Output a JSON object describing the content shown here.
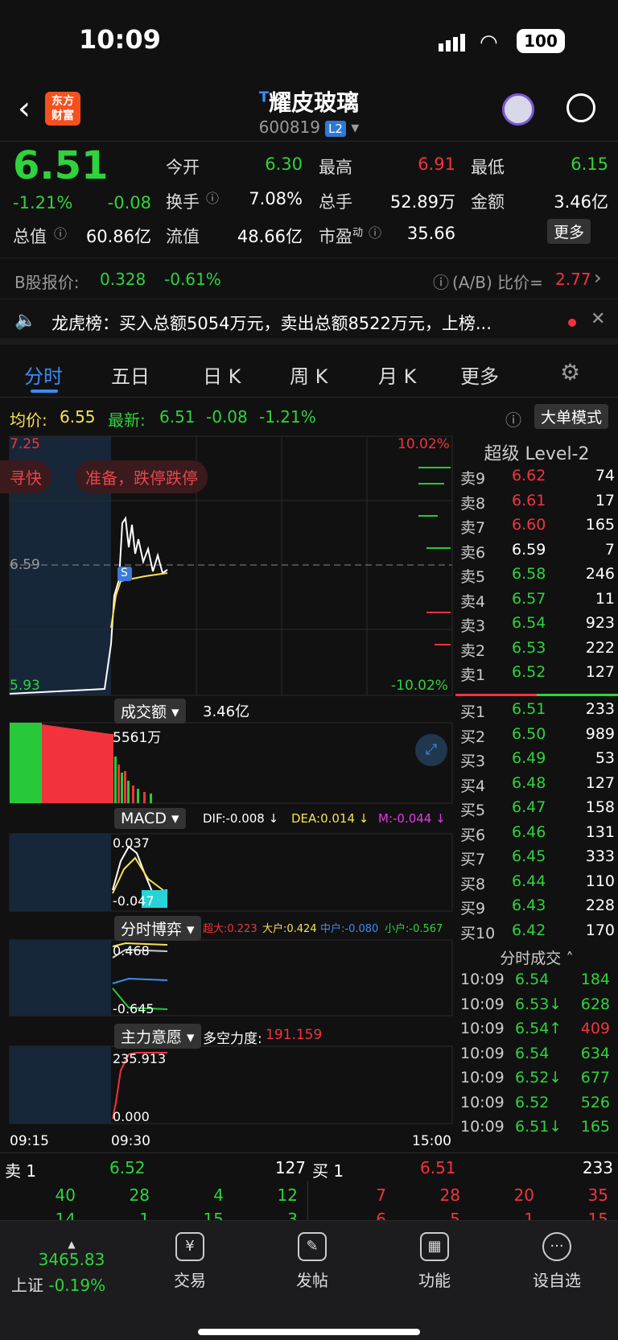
{
  "status": {
    "time": "10:09",
    "battery": "100"
  },
  "header": {
    "name": "耀皮玻璃",
    "prefix": "T",
    "code": "600819",
    "level": "L2",
    "logo_l1": "东方",
    "logo_l2": "财富"
  },
  "quote": {
    "price": "6.51",
    "pct": "-1.21%",
    "chg": "-0.08",
    "open_l": "今开",
    "open": "6.30",
    "high_l": "最高",
    "high": "6.91",
    "low_l": "最低",
    "low": "6.15",
    "turn_l": "换手",
    "turn": "7.08%",
    "vol_l": "总手",
    "vol": "52.89万",
    "amt_l": "金额",
    "amt": "3.46亿",
    "mcap_l": "总值",
    "mcap": "60.86亿",
    "float_l": "流值",
    "float": "48.66亿",
    "pe_l": "市盈",
    "pe_sup": "动",
    "pe": "35.66",
    "more": "更多"
  },
  "bshare": {
    "label": "B股报价:",
    "price": "0.328",
    "pct": "-0.61%",
    "ratio_l": "(A/B) 比价=",
    "ratio": "2.77"
  },
  "dragon": {
    "text": "龙虎榜：买入总额5054万元，卖出总额8522万元，上榜..."
  },
  "tabs": [
    "分时",
    "五日",
    "日 K",
    "周 K",
    "月 K",
    "更多"
  ],
  "info": {
    "avg_l": "均价:",
    "avg": "6.55",
    "last_l": "最新:",
    "last": "6.51",
    "chg": "-0.08",
    "pct": "-1.21%",
    "mode": "大单模式"
  },
  "chart": {
    "top_price": "7.25",
    "bottom_price": "5.93",
    "ref_price": "6.59",
    "top_pct": "10.02%",
    "bottom_pct": "-10.02%",
    "pill1": "寻快",
    "pill2": "准备，跌停跌停",
    "marker": "S",
    "vol_label": "成交额",
    "vol_value": "3.46亿",
    "vol_max": "5561万",
    "macd_label": "MACD",
    "dif": "DIF:-0.008 ↓",
    "dea": "DEA:0.014 ↓",
    "m": "M:-0.044 ↓",
    "macd_top": "0.037",
    "macd_bot": "-0.047",
    "game_label": "分时博弈",
    "super": "超大:0.223",
    "big": "大户:0.424",
    "mid": "中户:-0.080",
    "small": "小户:-0.567",
    "game_top": "0.468",
    "game_bot": "-0.645",
    "main_label": "主力意愿",
    "force_l": "多空力度:",
    "force": "191.159",
    "main_top": "235.913",
    "main_bot": "0.000",
    "t_start": "09:15",
    "t_open": "09:30",
    "t_end": "15:00"
  },
  "chart_data": {
    "type": "line",
    "x": [
      "09:15",
      "09:30",
      "15:00"
    ],
    "ylim": [
      5.93,
      7.25
    ],
    "reference": 6.59,
    "series": [
      {
        "name": "最新",
        "values": [
          6.15,
          6.91,
          6.51
        ]
      },
      {
        "name": "均价",
        "values": [
          6.3,
          6.55,
          6.55
        ]
      }
    ]
  },
  "level2": {
    "title": "超级 Level-2",
    "asks": [
      [
        "卖9",
        "6.62",
        "74"
      ],
      [
        "卖8",
        "6.61",
        "17"
      ],
      [
        "卖7",
        "6.60",
        "165"
      ],
      [
        "卖6",
        "6.59",
        "7"
      ],
      [
        "卖5",
        "6.58",
        "246"
      ],
      [
        "卖4",
        "6.57",
        "11"
      ],
      [
        "卖3",
        "6.54",
        "923"
      ],
      [
        "卖2",
        "6.53",
        "222"
      ],
      [
        "卖1",
        "6.52",
        "127"
      ]
    ],
    "bids": [
      [
        "买1",
        "6.51",
        "233"
      ],
      [
        "买2",
        "6.50",
        "989"
      ],
      [
        "买3",
        "6.49",
        "53"
      ],
      [
        "买4",
        "6.48",
        "127"
      ],
      [
        "买5",
        "6.47",
        "158"
      ],
      [
        "买6",
        "6.46",
        "131"
      ],
      [
        "买7",
        "6.45",
        "333"
      ],
      [
        "买8",
        "6.44",
        "110"
      ],
      [
        "买9",
        "6.43",
        "228"
      ],
      [
        "买10",
        "6.42",
        "170"
      ]
    ],
    "ticks_title": "分时成交",
    "ticks": [
      [
        "10:09",
        "6.54",
        "",
        "184"
      ],
      [
        "10:09",
        "6.53",
        "↓",
        "628"
      ],
      [
        "10:09",
        "6.54",
        "↑",
        "409"
      ],
      [
        "10:09",
        "6.54",
        "",
        "634"
      ],
      [
        "10:09",
        "6.52",
        "↓",
        "677"
      ],
      [
        "10:09",
        "6.52",
        "",
        "526"
      ],
      [
        "10:09",
        "6.51",
        "↓",
        "165"
      ]
    ]
  },
  "queue": {
    "sell_l": "卖 1",
    "sell_p": "6.52",
    "sell_v": "127",
    "buy_l": "买 1",
    "buy_p": "6.51",
    "buy_v": "233",
    "sell_row1": [
      "40",
      "28",
      "4",
      "12"
    ],
    "buy_row1": [
      "7",
      "28",
      "20",
      "35"
    ],
    "sell_row2": [
      "14",
      "1",
      "15",
      "3"
    ],
    "buy_row2": [
      "6",
      "5",
      "1",
      "15"
    ]
  },
  "bottom": {
    "index": "3465.83",
    "index_name": "上证",
    "index_pct": "-0.19%",
    "nav": [
      "交易",
      "发帖",
      "功能",
      "设自选"
    ]
  }
}
